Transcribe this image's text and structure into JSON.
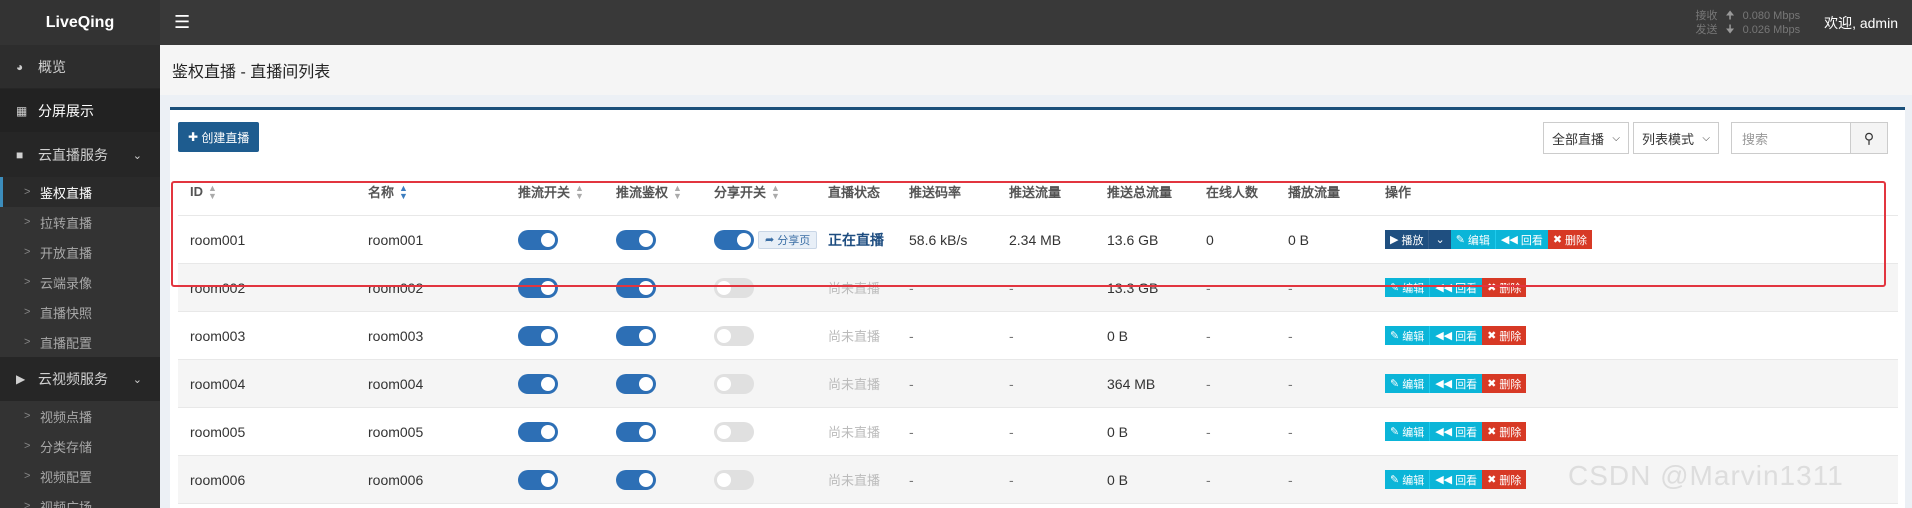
{
  "app": {
    "brand": "LiveQing",
    "welcome": "欢迎, admin"
  },
  "net": {
    "recv_label": "接收",
    "recv_value": "0.080 Mbps",
    "send_label": "发送",
    "send_value": "0.026 Mbps"
  },
  "sidebar": {
    "top": [
      {
        "label": "概览",
        "icon": "dashboard-icon"
      },
      {
        "label": "分屏展示",
        "icon": "grid-icon"
      }
    ],
    "group1": {
      "label": "云直播服务",
      "icon": "video-camera-icon"
    },
    "group1_items": [
      "鉴权直播",
      "拉转直播",
      "开放直播",
      "云端录像",
      "直播快照",
      "直播配置"
    ],
    "group2": {
      "label": "云视频服务",
      "icon": "youtube-play-icon"
    },
    "group2_items": [
      "视频点播",
      "分类存储",
      "视频配置",
      "视频广场"
    ]
  },
  "page": {
    "title": "鉴权直播 - 直播间列表"
  },
  "toolbar": {
    "create_label": "创建直播",
    "filter_value": "全部直播",
    "mode_value": "列表模式",
    "search_placeholder": "搜索"
  },
  "table": {
    "headers": {
      "id": "ID",
      "name": "名称",
      "push_switch": "推流开关",
      "push_auth": "推流鉴权",
      "share_switch": "分享开关",
      "status": "直播状态",
      "bitrate": "推送码率",
      "traffic": "推送流量",
      "total_traffic": "推送总流量",
      "online": "在线人数",
      "play_traffic": "播放流量",
      "ops": "操作"
    },
    "rows": [
      {
        "id": "room001",
        "name": "room001",
        "status": "正在直播",
        "bitrate": "58.6 kB/s",
        "traffic": "2.34 MB",
        "total": "13.6 GB",
        "online": "0",
        "play": "0 B",
        "share": true,
        "share_label": "分享页"
      },
      {
        "id": "room002",
        "name": "room002",
        "status": "尚未直播",
        "bitrate": "-",
        "traffic": "-",
        "total": "13.3 GB",
        "online": "-",
        "play": "-",
        "share": false
      },
      {
        "id": "room003",
        "name": "room003",
        "status": "尚未直播",
        "bitrate": "-",
        "traffic": "-",
        "total": "0 B",
        "online": "-",
        "play": "-",
        "share": false
      },
      {
        "id": "room004",
        "name": "room004",
        "status": "尚未直播",
        "bitrate": "-",
        "traffic": "-",
        "total": "364 MB",
        "online": "-",
        "play": "-",
        "share": false
      },
      {
        "id": "room005",
        "name": "room005",
        "status": "尚未直播",
        "bitrate": "-",
        "traffic": "-",
        "total": "0 B",
        "online": "-",
        "play": "-",
        "share": false
      },
      {
        "id": "room006",
        "name": "room006",
        "status": "尚未直播",
        "bitrate": "-",
        "traffic": "-",
        "total": "0 B",
        "online": "-",
        "play": "-",
        "share": false
      }
    ],
    "ops": {
      "play": "播放",
      "edit": "编辑",
      "playback": "回看",
      "delete": "删除"
    }
  },
  "watermark": "CSDN @Marvin1311",
  "colors": {
    "accent": "#1e5c8f",
    "live": "#1e4d80",
    "danger": "#d73925",
    "info": "#0bb5d8",
    "highlight": "#e2353f"
  }
}
